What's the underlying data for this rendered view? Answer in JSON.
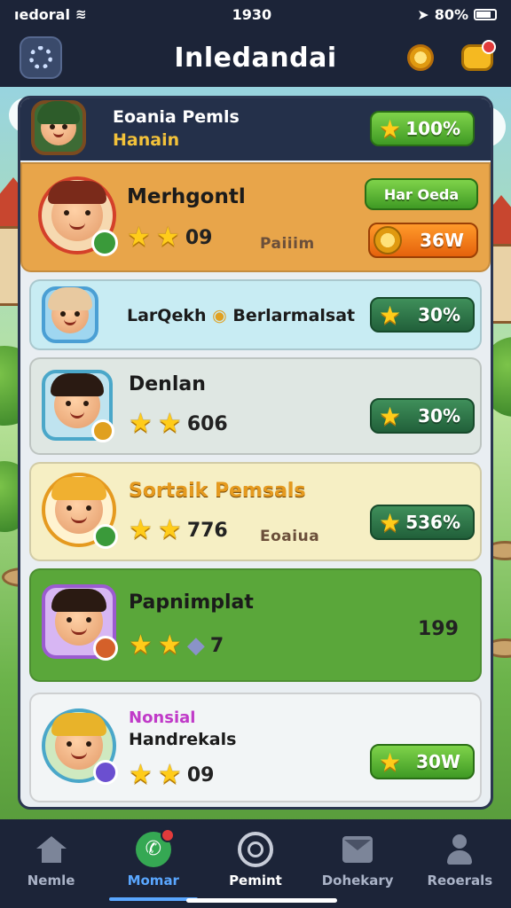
{
  "status_bar": {
    "carrier": "ıedoral",
    "time": "1930",
    "battery": "80%"
  },
  "header": {
    "title": "Inledandai"
  },
  "leaderboard_header": {
    "line1": "Eoania Pemls",
    "line2": "Hanain",
    "pill": "100%"
  },
  "rows": [
    {
      "name": "Merhgontl",
      "stars_value": "09",
      "sub": "Paiiim",
      "top_pill": "Har Oeda",
      "pill": "36W",
      "colors": {
        "bg": "#e8a54a",
        "hair": "#7a2a1a",
        "frame": "#d4402a"
      }
    },
    {
      "name": "LarQekh",
      "extra": "Berlarmalsat",
      "pill": "30%",
      "colors": {
        "bg": "#c8ecf3",
        "hair": "#e8c9a0",
        "frame": "#4a9fd4"
      }
    },
    {
      "name": "Denlan",
      "stars_value": "606",
      "pill": "30%",
      "colors": {
        "bg": "#dfe7e3",
        "hair": "#2a1a12",
        "frame": "#4aa7c9"
      }
    },
    {
      "name": "Sortaik Pemsals",
      "stars_value": "776",
      "sub": "Eoaiua",
      "pill": "536%",
      "colors": {
        "bg": "#f6efc4",
        "hair": "#f0b030",
        "frame": "#e59a1f"
      }
    },
    {
      "name": "Papnimplat",
      "stars_value": "7",
      "right_value": "199",
      "colors": {
        "bg": "#5aa73a",
        "hair": "#2a1a12",
        "frame": "#9b5bd0"
      }
    },
    {
      "name_line1": "Nonsial",
      "name_line2": "Handrekals",
      "stars_value": "09",
      "pill": "30W",
      "colors": {
        "bg": "#f2f5f6",
        "hair": "#e8b32a",
        "frame": "#4aa7c9"
      }
    }
  ],
  "nav": {
    "items": [
      {
        "label": "Nemle"
      },
      {
        "label": "Momar"
      },
      {
        "label": "Pemint"
      },
      {
        "label": "Dohekary"
      },
      {
        "label": "Reoerals"
      }
    ]
  }
}
